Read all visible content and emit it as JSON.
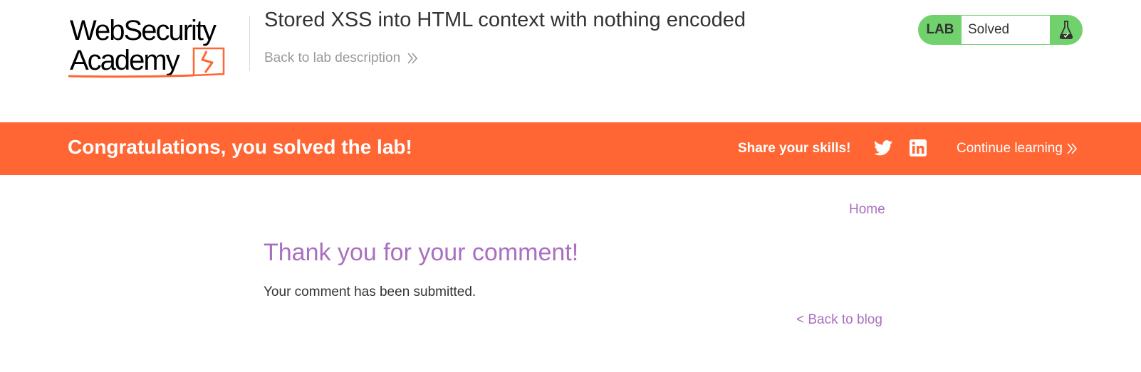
{
  "logo": {
    "line1": "WebSecurity",
    "line2": "Academy"
  },
  "header": {
    "lab_title": "Stored XSS into HTML context with nothing encoded",
    "back_to_description": "Back to lab description"
  },
  "lab_status": {
    "tag": "LAB",
    "state": "Solved",
    "icon": "flask-icon",
    "color": "#70d16d"
  },
  "banner": {
    "message": "Congratulations, you solved the lab!",
    "share_label": "Share your skills!",
    "twitter_icon": "twitter-icon",
    "linkedin_icon": "linkedin-icon",
    "continue_label": "Continue learning",
    "color": "#ff6633"
  },
  "content": {
    "home_link": "Home",
    "title": "Thank you for your comment!",
    "message": "Your comment has been submitted.",
    "back_link": "< Back to blog",
    "accent_color": "#a970c0"
  }
}
